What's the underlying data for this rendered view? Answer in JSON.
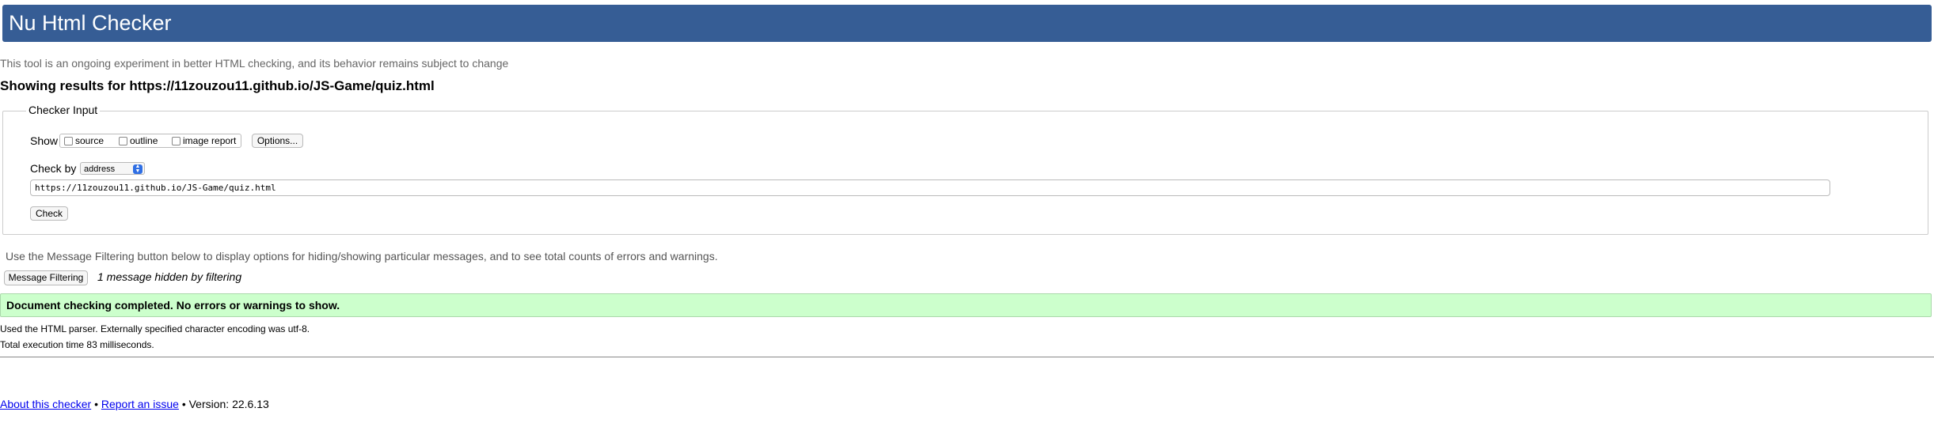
{
  "header": {
    "title": "Nu Html Checker"
  },
  "intro_note": "This tool is an ongoing experiment in better HTML checking, and its behavior remains subject to change",
  "results_title": "Showing results for https://11zouzou11.github.io/JS-Game/quiz.html",
  "checker_input": {
    "legend": "Checker Input",
    "show_label": "Show",
    "show_options": [
      {
        "label": "source",
        "checked": false
      },
      {
        "label": "outline",
        "checked": false
      },
      {
        "label": "image report",
        "checked": false
      }
    ],
    "options_button": "Options...",
    "check_by_label": "Check by",
    "check_by_value": "address",
    "url_value": "https://11zouzou11.github.io/JS-Game/quiz.html",
    "check_button": "Check"
  },
  "filter_note": "Use the Message Filtering button below to display options for hiding/showing particular messages, and to see total counts of errors and warnings.",
  "message_filtering_button": "Message Filtering",
  "hidden_message": "1 message hidden by filtering",
  "success_message": "Document checking completed. No errors or warnings to show.",
  "parser_info": "Used the HTML parser. Externally specified character encoding was utf-8.",
  "execution_time": "Total execution time 83 milliseconds.",
  "footer": {
    "about_link": "About this checker",
    "separator": "•",
    "report_link": "Report an issue",
    "version": "Version: 22.6.13"
  },
  "colors": {
    "header_bg": "#365d95",
    "success_bg": "#ccffcc",
    "link": "#0000ee"
  }
}
